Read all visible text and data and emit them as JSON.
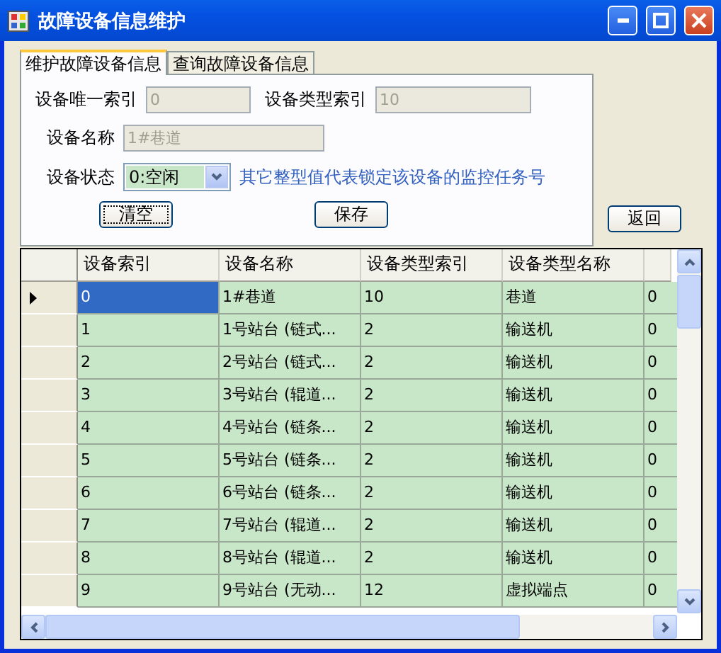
{
  "window": {
    "title": "故障设备信息维护"
  },
  "tabs": [
    {
      "label": "维护故障设备信息",
      "selected": true
    },
    {
      "label": "查询故障设备信息",
      "selected": false
    }
  ],
  "form": {
    "unique_index": {
      "label": "设备唯一索引",
      "value": "0",
      "disabled": true
    },
    "type_index": {
      "label": "设备类型索引",
      "value": "10",
      "disabled": true
    },
    "name": {
      "label": "设备名称",
      "value": "1#巷道",
      "disabled": true
    },
    "status": {
      "label": "设备状态",
      "value": "0:空闲",
      "hint": "其它整型值代表锁定该设备的监控任务号"
    }
  },
  "buttons": [
    {
      "label": "清空",
      "focused": true
    },
    {
      "label": "保存",
      "focused": false
    }
  ],
  "back_button": "返回",
  "table": {
    "columns": [
      "设备索引",
      "设备名称",
      "设备类型索引",
      "设备类型名称"
    ],
    "rows": [
      {
        "selected": true,
        "cells": [
          "0",
          "1#巷道",
          "10",
          "巷道",
          "0"
        ]
      },
      {
        "selected": false,
        "cells": [
          "1",
          "1号站台 (链式...",
          "2",
          "输送机",
          "0"
        ]
      },
      {
        "selected": false,
        "cells": [
          "2",
          "2号站台 (链式...",
          "2",
          "输送机",
          "0"
        ]
      },
      {
        "selected": false,
        "cells": [
          "3",
          "3号站台 (辊道...",
          "2",
          "输送机",
          "0"
        ]
      },
      {
        "selected": false,
        "cells": [
          "4",
          "4号站台 (链条...",
          "2",
          "输送机",
          "0"
        ]
      },
      {
        "selected": false,
        "cells": [
          "5",
          "5号站台 (链条...",
          "2",
          "输送机",
          "0"
        ]
      },
      {
        "selected": false,
        "cells": [
          "6",
          "6号站台 (链条...",
          "2",
          "输送机",
          "0"
        ]
      },
      {
        "selected": false,
        "cells": [
          "7",
          "7号站台 (辊道...",
          "2",
          "输送机",
          "0"
        ]
      },
      {
        "selected": false,
        "cells": [
          "8",
          "8号站台 (辊道...",
          "2",
          "输送机",
          "0"
        ]
      },
      {
        "selected": false,
        "cells": [
          "9",
          "9号站台 (无动...",
          "12",
          "虚拟端点",
          "0"
        ]
      }
    ]
  }
}
